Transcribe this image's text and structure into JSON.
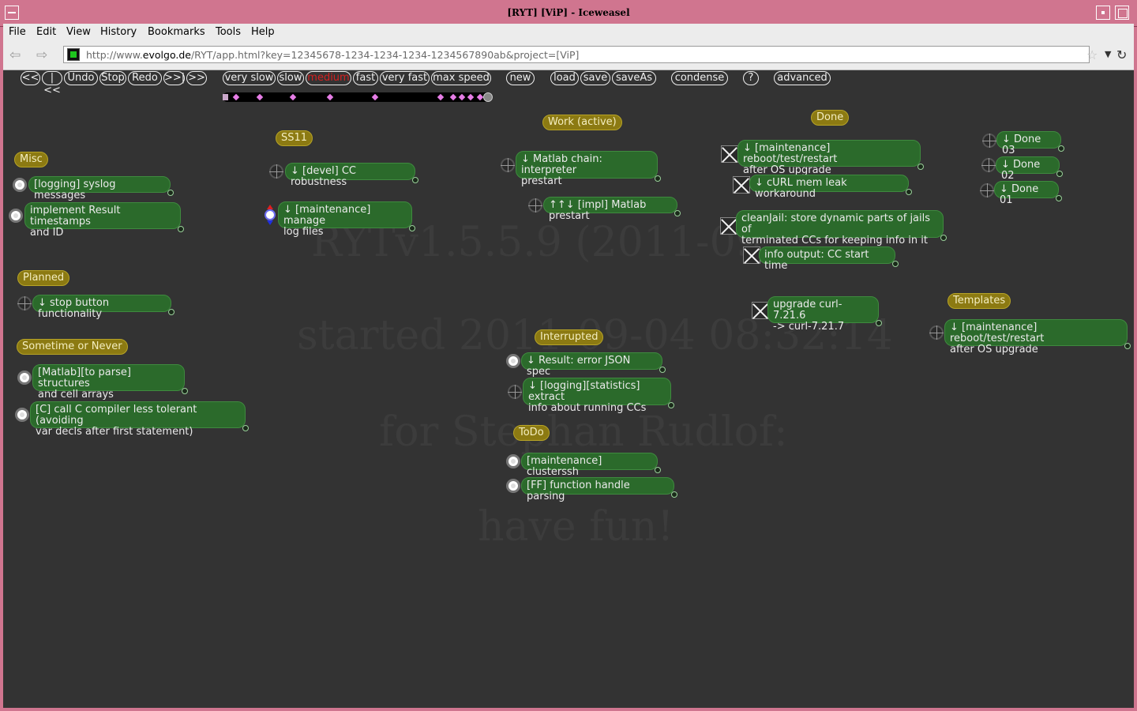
{
  "window": {
    "title": "[RYT] [ViP] - Iceweasel"
  },
  "menu": [
    "File",
    "Edit",
    "View",
    "History",
    "Bookmarks",
    "Tools",
    "Help"
  ],
  "nav": {
    "url_prefix": "http://www.",
    "url_domain": "evolgo.de",
    "url_rest": "/RYT/app.html?key=12345678-1234-1234-1234-1234567890ab&project=[ViP]"
  },
  "toolbar": {
    "back_all": "<<",
    "back_step": "|<<",
    "undo": "Undo",
    "stop": "Stop",
    "redo": "Redo",
    "fwd_step": ">>|",
    "fwd_all": ">>",
    "speeds": [
      "very slow",
      "slow",
      "medium",
      "fast",
      "very fast",
      "max speed"
    ],
    "active_speed": "medium",
    "new": "new",
    "load": "load",
    "save": "save",
    "saveAs": "saveAs",
    "condense": "condense",
    "help": "?",
    "advanced": "advanced"
  },
  "watermark": [
    "RYTv1.5.5.9 (2011-09",
    "started 2011-09-04 08:32:14",
    "for Stephan Rudlof:",
    "have fun!"
  ],
  "groups": {
    "misc": "Misc",
    "ss11": "SS11",
    "work": "Work (active)",
    "done": "Done",
    "planned": "Planned",
    "sometime": "Sometime or Never",
    "interrupted": "Interrupted",
    "todo": "ToDo",
    "templates": "Templates"
  },
  "nodes": {
    "misc1": "[logging] syslog messages",
    "misc2": "implement Result timestamps\nand ID",
    "ss11_1": "↓ [devel] CC robustness",
    "ss11_2": "↓ [maintenance] manage\nlog files",
    "work1": "↓ Matlab chain: interpreter\nprestart",
    "work2": "↑↑↓ [impl] Matlab prestart",
    "done1": "↓ [maintenance] reboot/test/restart\nafter OS upgrade",
    "done2": "↓ cURL mem leak workaround",
    "done3": "cleanJail: store dynamic parts of jails of\nterminated CCs for keeping info in it",
    "done4": "info output: CC start time",
    "done5": "upgrade curl-7.21.6\n-> curl-7.21.7",
    "done03": "↓ Done 03",
    "done02": "↓ Done 02",
    "done01": "↓ Done 01",
    "planned1": "↓ stop button functionality",
    "some1": "[Matlab][to parse] structures\nand cell arrays",
    "some2": "[C] call C compiler less tolerant (avoiding\nvar decls after first statement)",
    "int1": "↓ Result: error JSON spec",
    "int2": "↓ [logging][statistics] extract\ninfo about running CCs",
    "todo1": "[maintenance] clusterssh",
    "todo2": "[FF] function handle parsing",
    "templ1": "↓ [maintenance] reboot/test/restart\nafter OS upgrade"
  },
  "colors": {
    "background": "#333333",
    "group": "#8c7a12",
    "node": "#2b6a2b",
    "active_speed": "#d42020",
    "chrome": "#d0758f"
  }
}
